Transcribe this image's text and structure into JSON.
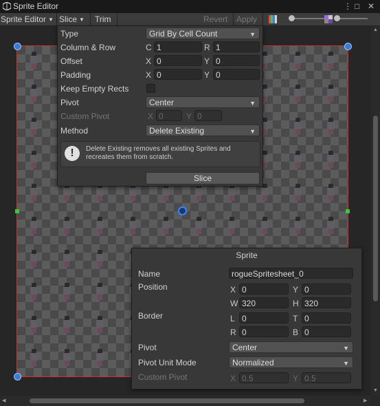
{
  "window": {
    "title": "Sprite Editor"
  },
  "toolbar": {
    "mode_label": "Sprite Editor",
    "slice_label": "Slice",
    "trim_label": "Trim",
    "revert_label": "Revert",
    "apply_label": "Apply"
  },
  "slice_popup": {
    "type_label": "Type",
    "type_value": "Grid By Cell Count",
    "column_row_label": "Column & Row",
    "c_label": "C",
    "c_value": "1",
    "r_label": "R",
    "r_value": "1",
    "offset_label": "Offset",
    "offset_x_label": "X",
    "offset_x": "0",
    "offset_y_label": "Y",
    "offset_y": "0",
    "padding_label": "Padding",
    "padding_x_label": "X",
    "padding_x": "0",
    "padding_y_label": "Y",
    "padding_y": "0",
    "keep_empty_label": "Keep Empty Rects",
    "keep_empty_checked": false,
    "pivot_label": "Pivot",
    "pivot_value": "Center",
    "custom_pivot_label": "Custom Pivot",
    "custom_x_label": "X",
    "custom_x": "0",
    "custom_y_label": "Y",
    "custom_y": "0",
    "method_label": "Method",
    "method_value": "Delete Existing",
    "info_text": "Delete Existing removes all existing Sprites and recreates them from scratch.",
    "slice_button": "Slice"
  },
  "sprite_panel": {
    "title": "Sprite",
    "name_label": "Name",
    "name_value": "rogueSpritesheet_0",
    "position_label": "Position",
    "pos_x_label": "X",
    "pos_x": "0",
    "pos_y_label": "Y",
    "pos_y": "0",
    "pos_w_label": "W",
    "pos_w": "320",
    "pos_h_label": "H",
    "pos_h": "320",
    "border_label": "Border",
    "border_l_label": "L",
    "border_l": "0",
    "border_t_label": "T",
    "border_t": "0",
    "border_r_label": "R",
    "border_r": "0",
    "border_b_label": "B",
    "border_b": "0",
    "pivot_label": "Pivot",
    "pivot_value": "Center",
    "pivot_unit_label": "Pivot Unit Mode",
    "pivot_unit_value": "Normalized",
    "custom_pivot_label": "Custom Pivot",
    "custom_x_label": "X",
    "custom_x": "0.5",
    "custom_y_label": "Y",
    "custom_y": "0.5"
  },
  "colors": {
    "accent": "#3a7bd5",
    "selection_outline": "#d03030",
    "edge_handle": "#3ac63a"
  }
}
